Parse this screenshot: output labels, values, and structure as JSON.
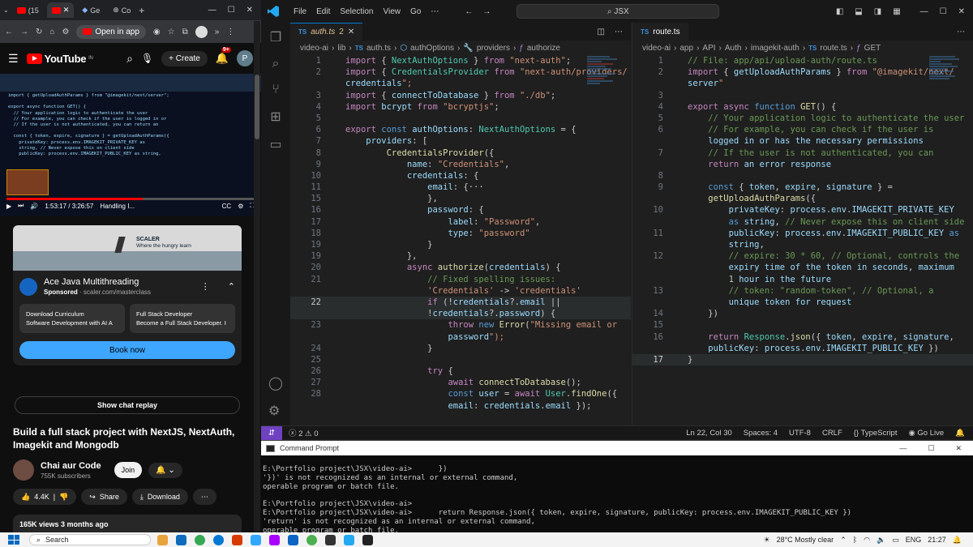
{
  "browser": {
    "tabs": [
      {
        "label": "(15",
        "icon": "youtube-icon"
      },
      {
        "label": "",
        "icon": "youtube-icon"
      },
      {
        "label": "Ge",
        "icon": "gemini-icon"
      },
      {
        "label": "Co",
        "icon": "globe-icon"
      }
    ],
    "new_tab": "+",
    "open_in_app": "Open in app"
  },
  "youtube": {
    "logo": "YouTube",
    "logo_region": "IN",
    "create": "Create",
    "notifications": "9+",
    "avatar": "P",
    "player": {
      "time": "1:53:17 / 3:26:57",
      "chapter": "Handling I...",
      "progress": 0.55,
      "code_lines": [
        "import { getUploadAuthParams } from \"@imagekit/next/server\";",
        "",
        "export async function GET() {",
        "  // Your application logic to authenticate the user",
        "  // For example, you can check if the user is logged in or",
        "  // If the user is not authenticated, you can return an",
        "",
        "  const { token, expire, signature } = getUploadAuthParams({",
        "    privateKey: process.env.IMAGEKIT_PRIVATE_KEY as",
        "    string, // Never expose this on client side",
        "    publicKey: process.env.IMAGEKIT_PUBLIC_KEY as string,"
      ]
    },
    "ad": {
      "banner_brand": "SCALER",
      "banner_tagline": "Where the hungry learn",
      "title": "Ace Java Multithreading",
      "sponsored": "Sponsored",
      "url": "scaler.com/masterclass",
      "cards": [
        {
          "title": "Download Curriculum",
          "sub": "Software Development with AI A"
        },
        {
          "title": "Full Stack Developer",
          "sub": "Become a Full Stack Developer. I"
        }
      ],
      "cta": "Book now"
    },
    "chat_replay": "Show chat replay",
    "video_title": "Build a full stack project with NextJS, NextAuth, Imagekit and Mongodb",
    "channel": "Chai aur Code",
    "subscribers": "755K subscribers",
    "join": "Join",
    "likes": "4.4K",
    "share": "Share",
    "download": "Download",
    "views": "165K views  3 months ago"
  },
  "vscode": {
    "menu": [
      "File",
      "Edit",
      "Selection",
      "View",
      "Go"
    ],
    "search": "JSX",
    "left_tab": {
      "file": "auth.ts",
      "problems": "2"
    },
    "left_breadcrumb": [
      "video-ai",
      "lib",
      "auth.ts",
      "authOptions",
      "providers",
      "authorize"
    ],
    "right_tab": {
      "file": "route.ts"
    },
    "right_breadcrumb": [
      "video-ai",
      "app",
      "API",
      "Auth",
      "imagekit-auth",
      "route.ts",
      "GET"
    ],
    "left_lines": [
      {
        "n": "1",
        "t": "import { NextAuthOptions } from \"next-auth\";"
      },
      {
        "n": "2",
        "t": "import { CredentialsProvider from \"next-auth/providers/"
      },
      {
        "n": "",
        "t": "credentials\";"
      },
      {
        "n": "3",
        "t": "import { connectToDatabase } from \"./db\";"
      },
      {
        "n": "4",
        "t": "import bcrypt from \"bcryptjs\";"
      },
      {
        "n": "5",
        "t": ""
      },
      {
        "n": "6",
        "t": "export const authOptions: NextAuthOptions = {"
      },
      {
        "n": "7",
        "t": "    providers: ["
      },
      {
        "n": "8",
        "t": "        CredentialsProvider({"
      },
      {
        "n": "9",
        "t": "            name: \"Credentials\","
      },
      {
        "n": "10",
        "t": "            credentials: {"
      },
      {
        "n": "11",
        "t": "                email: {···"
      },
      {
        "n": "15",
        "t": "                },"
      },
      {
        "n": "16",
        "t": "                password: {"
      },
      {
        "n": "17",
        "t": "                    label: \"Password\","
      },
      {
        "n": "18",
        "t": "                    type: \"password\""
      },
      {
        "n": "19",
        "t": "                }"
      },
      {
        "n": "19",
        "t": "            },"
      },
      {
        "n": "20",
        "t": "            async authorize(credentials) {"
      },
      {
        "n": "21",
        "t": "                // Fixed spelling issues:"
      },
      {
        "n": "",
        "t": "                'Credentials' -> 'credentials'"
      },
      {
        "n": "22",
        "t": "                if (!credentials?.email ||"
      },
      {
        "n": "",
        "t": "                !credentials?.password) {"
      },
      {
        "n": "23",
        "t": "                    throw new Error(\"Missing email or"
      },
      {
        "n": "",
        "t": "                    password\");"
      },
      {
        "n": "24",
        "t": "                }"
      },
      {
        "n": "25",
        "t": ""
      },
      {
        "n": "26",
        "t": "                try {"
      },
      {
        "n": "27",
        "t": "                    await connectToDatabase();"
      },
      {
        "n": "28",
        "t": "                    const user = await User.findOne({"
      },
      {
        "n": "",
        "t": "                    email: credentials.email });"
      }
    ],
    "right_lines": [
      {
        "n": "1",
        "t": "// File: app/api/upload-auth/route.ts"
      },
      {
        "n": "2",
        "t": "import { getUploadAuthParams } from \"@imagekit/next/"
      },
      {
        "n": "",
        "t": "server\""
      },
      {
        "n": "3",
        "t": ""
      },
      {
        "n": "4",
        "t": "export async function GET() {"
      },
      {
        "n": "5",
        "t": "    // Your application logic to authenticate the user"
      },
      {
        "n": "6",
        "t": "    // For example, you can check if the user is"
      },
      {
        "n": "",
        "t": "    logged in or has the necessary permissions"
      },
      {
        "n": "7",
        "t": "    // If the user is not authenticated, you can"
      },
      {
        "n": "",
        "t": "    return an error response"
      },
      {
        "n": "8",
        "t": ""
      },
      {
        "n": "9",
        "t": "    const { token, expire, signature } ="
      },
      {
        "n": "",
        "t": "    getUploadAuthParams({"
      },
      {
        "n": "10",
        "t": "        privateKey: process.env.IMAGEKIT_PRIVATE_KEY"
      },
      {
        "n": "",
        "t": "        as string, // Never expose this on client side"
      },
      {
        "n": "11",
        "t": "        publicKey: process.env.IMAGEKIT_PUBLIC_KEY as"
      },
      {
        "n": "",
        "t": "        string,"
      },
      {
        "n": "12",
        "t": "        // expire: 30 * 60, // Optional, controls the"
      },
      {
        "n": "",
        "t": "        expiry time of the token in seconds, maximum"
      },
      {
        "n": "",
        "t": "        1 hour in the future"
      },
      {
        "n": "13",
        "t": "        // token: \"random-token\", // Optional, a"
      },
      {
        "n": "",
        "t": "        unique token for request"
      },
      {
        "n": "14",
        "t": "    })"
      },
      {
        "n": "15",
        "t": ""
      },
      {
        "n": "16",
        "t": "    return Response.json({ token, expire, signature,"
      },
      {
        "n": "",
        "t": "    publicKey: process.env.IMAGEKIT_PUBLIC_KEY })"
      },
      {
        "n": "17",
        "t": "}"
      }
    ],
    "status": {
      "problems": "ⓧ 2 ⚠ 0",
      "position": "Ln 22, Col 30",
      "spaces": "Spaces: 4",
      "encoding": "UTF-8",
      "eol": "CRLF",
      "language": "{} TypeScript",
      "golive": "Go Live"
    }
  },
  "cmd": {
    "title": "Command Prompt",
    "lines": [
      "E:\\Portfolio project\\JSX\\video-ai>      })",
      "'})' is not recognized as an internal or external command,",
      "operable program or batch file.",
      "",
      "E:\\Portfolio project\\JSX\\video-ai>",
      "E:\\Portfolio project\\JSX\\video-ai>      return Response.json({ token, expire, signature, publicKey: process.env.IMAGEKIT_PUBLIC_KEY })",
      "'return' is not recognized as an internal or external command,",
      "operable program or batch file."
    ]
  },
  "taskbar": {
    "search": "Search",
    "weather": "28°C  Mostly clear",
    "lang": "ENG",
    "time": "21:27"
  }
}
